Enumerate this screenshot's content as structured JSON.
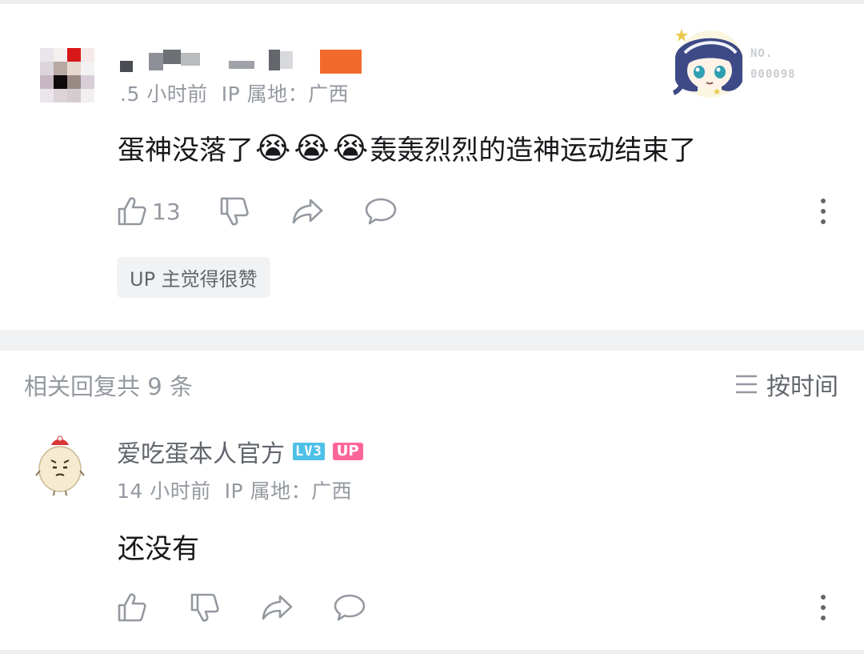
{
  "comment": {
    "time": ".5 小时前",
    "location": "IP 属地：广西",
    "text_before": "蛋神没落了",
    "emoji": [
      "😭",
      "😭",
      "😭"
    ],
    "text_after": "轰轰烈烈的造神运动结束了",
    "like_count": "13",
    "up_tag": "UP 主觉得很赞",
    "sticker": {
      "label": "NO.",
      "number": "000098"
    },
    "icons": [
      "thumbs-up-icon",
      "thumbs-down-icon",
      "share-icon",
      "comment-icon",
      "more-icon"
    ]
  },
  "replies": {
    "header": "相关回复共 9 条",
    "sort_label": "按时间",
    "items": [
      {
        "username": "爱吃蛋本人官方",
        "level_badge": "LV3",
        "up_badge": "UP",
        "time": "14 小时前",
        "location": "IP 属地：广西",
        "text": "还没有"
      }
    ]
  },
  "colors": {
    "text_primary": "#18191c",
    "text_secondary": "#9499a0",
    "level_badge": "#4fc0e8",
    "up_badge": "#ff6699",
    "divider": "#f1f2f3"
  }
}
